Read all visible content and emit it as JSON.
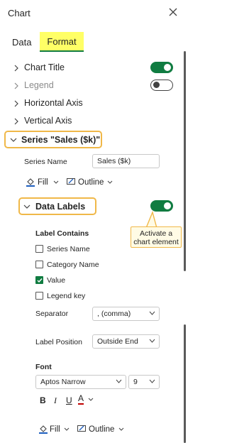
{
  "panel": {
    "title": "Chart"
  },
  "tabs": [
    {
      "label": "Data"
    },
    {
      "label": "Format"
    }
  ],
  "sections": {
    "chart_title": {
      "label": "Chart Title",
      "toggle_on": true
    },
    "legend": {
      "label": "Legend",
      "toggle_on": false
    },
    "horizontal_axis": {
      "label": "Horizontal Axis"
    },
    "vertical_axis": {
      "label": "Vertical Axis"
    },
    "series": {
      "label": "Series \"Sales ($k)\""
    }
  },
  "series_name": {
    "label": "Series Name",
    "value": "Sales ($k)"
  },
  "fill_outline": {
    "fill": "Fill",
    "outline": "Outline"
  },
  "data_labels": {
    "label": "Data Labels",
    "toggle_on": true,
    "callout": "Activate a chart element",
    "label_contains": "Label Contains",
    "options": [
      {
        "label": "Series Name",
        "checked": false
      },
      {
        "label": "Category Name",
        "checked": false
      },
      {
        "label": "Value",
        "checked": true
      },
      {
        "label": "Legend key",
        "checked": false
      }
    ],
    "separator_label": "Separator",
    "separator_value": ", (comma)",
    "position_label": "Label Position",
    "position_value": "Outside End"
  },
  "font": {
    "heading": "Font",
    "family": "Aptos Narrow",
    "size": "9",
    "bold": "B",
    "italic": "I",
    "underline": "U",
    "color": "A"
  },
  "bottom": {
    "fill": "Fill",
    "outline": "Outline"
  },
  "colors": {
    "accent": "#107c41",
    "highlight": "#ffff66",
    "callout_border": "#f0b848"
  }
}
